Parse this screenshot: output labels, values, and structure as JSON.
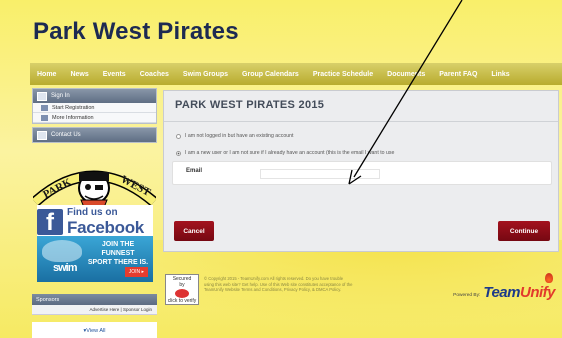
{
  "site": {
    "title": "Park West Pirates"
  },
  "nav": {
    "items": [
      "Home",
      "News",
      "Events",
      "Coaches",
      "Swim Groups",
      "Group Calendars",
      "Practice Schedule",
      "Documents",
      "Parent FAQ",
      "Links"
    ]
  },
  "sidebar": {
    "signin": {
      "label": "Sign In",
      "items": [
        "Start Registration",
        "More Information"
      ]
    },
    "contact": {
      "label": "Contact Us"
    },
    "logo": {
      "text_left": "PARK",
      "text_right": "WEST"
    },
    "facebook": {
      "line1": "Find us on",
      "line2": "Facebook"
    },
    "ad": {
      "line1": "JOIN THE FUNNEST",
      "line2": "SPORT THERE IS.",
      "logo": "swim",
      "button": "JOIN ▸"
    },
    "sponsors": {
      "label": "Sponsors",
      "row": "Advertise Here | Sponsor Login",
      "view_all": "▾View All"
    }
  },
  "main": {
    "title": "PARK WEST PIRATES 2015",
    "option1": "I am not logged in but have an existing account",
    "option2": "I am a new user or I am not sure if I already have an account (this is the email I want to use",
    "email_label": "Email",
    "email_value": "",
    "cancel": "Cancel",
    "continue": "Continue"
  },
  "footer": {
    "badge_line1": "Secured",
    "badge_line2": "by",
    "badge_line3": "click to verify",
    "text": "© Copyright 2015 - TeamUnify.com All rights reserved. Do you have trouble using this web site? Get help. Use of this Web site constitutes acceptance of the TeamUnify Website Terms and Conditions, Privacy Policy, & DMCA Policy.",
    "powered_by": "Powered By:",
    "brand_a": "Team",
    "brand_b": "Unify"
  },
  "colors": {
    "nav": "#b8ab2e",
    "button": "#a3121e",
    "title": "#1d2a52",
    "brand": "#1c3a8a"
  }
}
